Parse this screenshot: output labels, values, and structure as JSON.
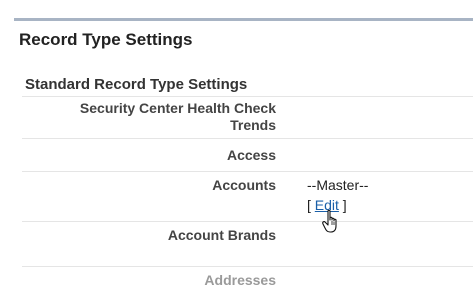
{
  "section_title": "Record Type Settings",
  "subsection_title": "Standard Record Type Settings",
  "rows": [
    {
      "label_line1": "Security Center Health Check",
      "label_line2": "Trends"
    },
    {
      "label": "Access"
    },
    {
      "label": "Accounts",
      "value": "--Master--",
      "bracket_open": "[",
      "edit_label": "Edit",
      "bracket_close": "]"
    },
    {
      "label": "Account Brands"
    },
    {
      "label": "Addresses"
    }
  ],
  "icons": {
    "cursor": "hand-pointer-icon"
  }
}
